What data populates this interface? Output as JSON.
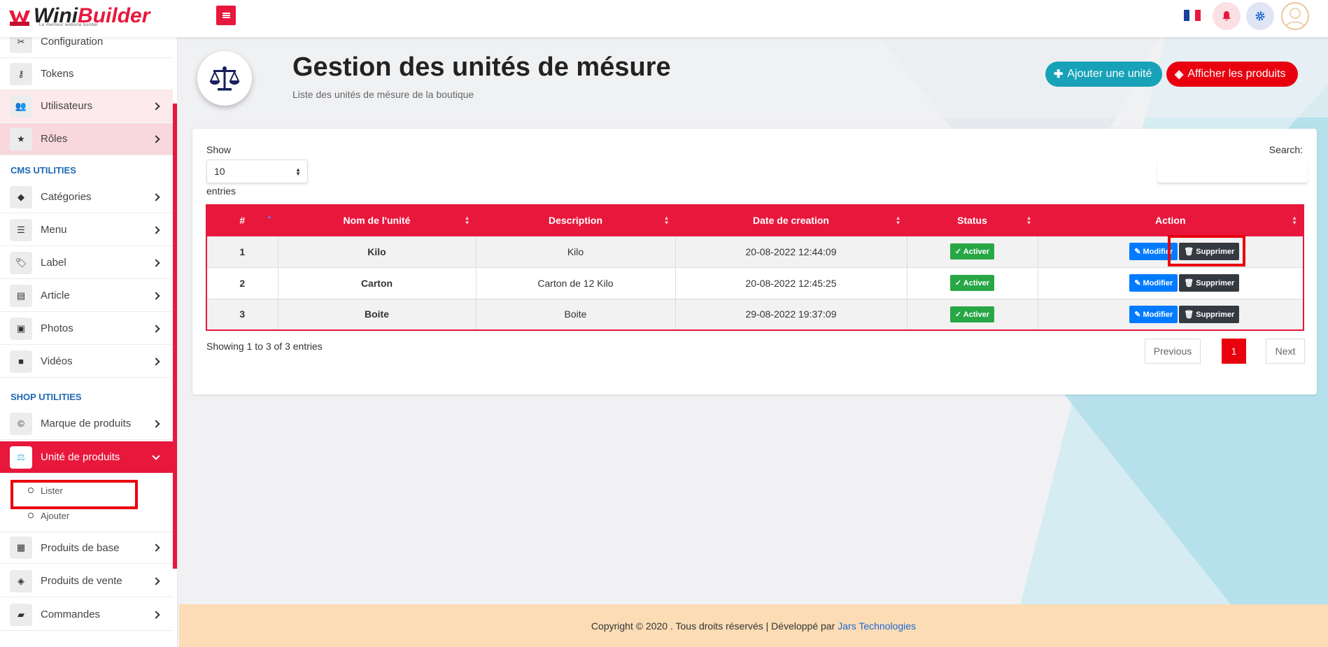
{
  "brand": {
    "name_part1": "Wini",
    "name_part2": "Builder",
    "tagline": "Le meilleur website builder"
  },
  "topbar": {
    "language": "fr",
    "icons": [
      "menu-toggle-icon",
      "french-flag-icon",
      "bell-icon",
      "gear-icon",
      "avatar"
    ]
  },
  "sidebar": {
    "items_top": [
      {
        "label": "Configuration",
        "icon": "tools-icon"
      },
      {
        "label": "Tokens",
        "icon": "key-icon"
      },
      {
        "label": "Utilisateurs",
        "icon": "users-icon"
      },
      {
        "label": "Rôles",
        "icon": "star-icon"
      }
    ],
    "section_cms": "CMS UTILITIES",
    "items_cms": [
      {
        "label": "Catégories",
        "icon": "shapes-icon"
      },
      {
        "label": "Menu",
        "icon": "bars-icon"
      },
      {
        "label": "Label",
        "icon": "tags-icon"
      },
      {
        "label": "Article",
        "icon": "newspaper-icon"
      },
      {
        "label": "Photos",
        "icon": "image-icon"
      },
      {
        "label": "Vidéos",
        "icon": "video-icon"
      }
    ],
    "section_shop": "SHOP UTILITIES",
    "items_shop": [
      {
        "label": "Marque de produits",
        "icon": "copyright-icon"
      },
      {
        "label": "Unité de produits",
        "icon": "scale-icon"
      }
    ],
    "subitems": [
      {
        "label": "Lister"
      },
      {
        "label": "Ajouter"
      }
    ],
    "items_bottom": [
      {
        "label": "Produits de base",
        "icon": "box-icon"
      },
      {
        "label": "Produits de vente",
        "icon": "layers-icon"
      },
      {
        "label": "Commandes",
        "icon": "bag-icon"
      }
    ]
  },
  "header": {
    "title": "Gestion des unités de mésure",
    "subtitle": "Liste des unités de mésure de la boutique",
    "add_button": "Ajouter une unité",
    "show_products_button": "Afficher les produits"
  },
  "table_controls": {
    "show_label": "Show",
    "length_value": "10",
    "entries_label": "entries",
    "search_label": "Search:",
    "search_value": ""
  },
  "table": {
    "columns": [
      "#",
      "Nom de l'unité",
      "Description",
      "Date de creation",
      "Status",
      "Action"
    ],
    "rows": [
      {
        "id": "1",
        "name": "Kilo",
        "description": "Kilo",
        "date": "20-08-2022 12:44:09",
        "status": "Activer",
        "edit": "Modifier",
        "delete": "Supprimer"
      },
      {
        "id": "2",
        "name": "Carton",
        "description": "Carton de 12 Kilo",
        "date": "20-08-2022 12:45:25",
        "status": "Activer",
        "edit": "Modifier",
        "delete": "Supprimer"
      },
      {
        "id": "3",
        "name": "Boite",
        "description": "Boite",
        "date": "29-08-2022 19:37:09",
        "status": "Activer",
        "edit": "Modifier",
        "delete": "Supprimer"
      }
    ],
    "info": "Showing 1 to 3 of 3 entries",
    "pagination": {
      "previous": "Previous",
      "current": "1",
      "next": "Next"
    }
  },
  "footer": {
    "text": "Copyright © 2020 . Tous droits réservés | Développé par",
    "link": "Jars Technologies"
  },
  "colors": {
    "primary": "#e8173c",
    "teal": "#17a2b8",
    "blue": "#007bff",
    "green": "#28a745",
    "dark": "#343a40",
    "section": "#1d68b3",
    "footer": "#fbdcb5"
  }
}
